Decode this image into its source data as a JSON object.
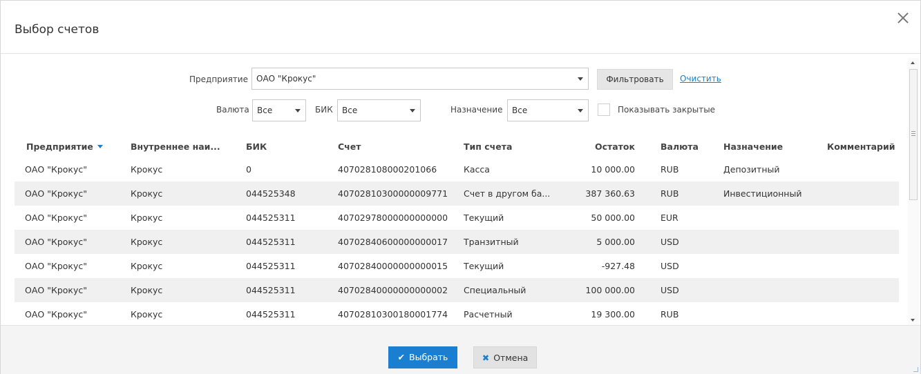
{
  "dialog": {
    "title": "Выбор счетов"
  },
  "filters": {
    "enterprise_label": "Предприятие",
    "enterprise_value": "ОАО \"Крокус\"",
    "filter_button": "Фильтровать",
    "clear_link": "Очистить",
    "currency_label": "Валюта",
    "currency_value": "Все",
    "bik_label": "БИК",
    "bik_value": "Все",
    "purpose_label": "Назначение",
    "purpose_value": "Все",
    "show_closed_label": "Показывать закрытые",
    "show_closed_checked": false
  },
  "table": {
    "columns": [
      "Предприятие",
      "Внутреннее наи...",
      "БИК",
      "Счет",
      "Тип счета",
      "Остаток",
      "Валюта",
      "Назначение",
      "Комментарий"
    ],
    "sorted_column": "Предприятие",
    "rows": [
      {
        "enterprise": "ОАО \"Крокус\"",
        "internal": "Крокус",
        "bik": "0",
        "account": "407028108000201066",
        "type": "Касса",
        "balance": "10 000.00",
        "currency": "RUB",
        "purpose": "Депозитный",
        "comment": ""
      },
      {
        "enterprise": "ОАО \"Крокус\"",
        "internal": "Крокус",
        "bik": "044525348",
        "account": "40702810300000009771",
        "type": "Счет в другом ба...",
        "balance": "387 360.63",
        "currency": "RUB",
        "purpose": "Инвестиционный",
        "comment": ""
      },
      {
        "enterprise": "ОАО \"Крокус\"",
        "internal": "Крокус",
        "bik": "044525311",
        "account": "40702978000000000000",
        "type": "Текущий",
        "balance": "50 000.00",
        "currency": "EUR",
        "purpose": "",
        "comment": ""
      },
      {
        "enterprise": "ОАО \"Крокус\"",
        "internal": "Крокус",
        "bik": "044525311",
        "account": "40702840600000000017",
        "type": "Транзитный",
        "balance": "5 000.00",
        "currency": "USD",
        "purpose": "",
        "comment": ""
      },
      {
        "enterprise": "ОАО \"Крокус\"",
        "internal": "Крокус",
        "bik": "044525311",
        "account": "40702840000000000015",
        "type": "Текущий",
        "balance": "-927.48",
        "currency": "USD",
        "purpose": "",
        "comment": ""
      },
      {
        "enterprise": "ОАО \"Крокус\"",
        "internal": "Крокус",
        "bik": "044525311",
        "account": "40702840000000000002",
        "type": "Специальный",
        "balance": "100 000.00",
        "currency": "USD",
        "purpose": "",
        "comment": ""
      },
      {
        "enterprise": "ОАО \"Крокус\"",
        "internal": "Крокус",
        "bik": "044525311",
        "account": "40702810300180001774",
        "type": "Расчетный",
        "balance": "19 300.00",
        "currency": "RUB",
        "purpose": "",
        "comment": ""
      }
    ]
  },
  "footer": {
    "ok_button": "Выбрать",
    "cancel_button": "Отмена"
  },
  "colors": {
    "accent": "#1a7fd1",
    "row_alt": "#f0f0f0",
    "footer_bg": "#f4f4f4"
  },
  "icons": {
    "close": "close-icon",
    "ok": "checkmark-icon",
    "cancel": "cancel-x-icon",
    "sort": "sort-descending-icon"
  }
}
